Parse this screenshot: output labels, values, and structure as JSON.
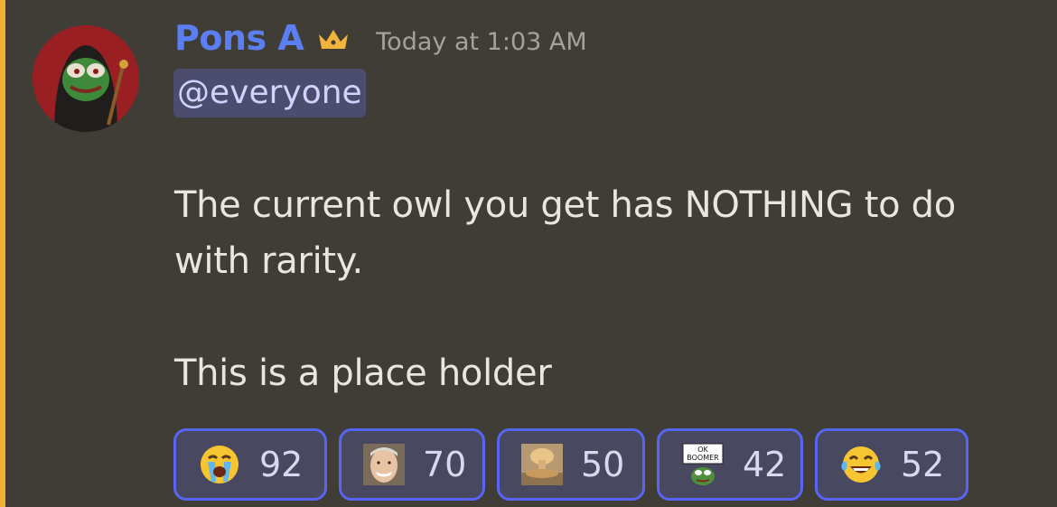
{
  "message": {
    "author": "Pons A",
    "author_badge": "crown-icon",
    "timestamp": "Today at 1:03 AM",
    "mention": "@everyone",
    "lines": [
      "The current owl you get has NOTHING to do",
      "with rarity.",
      "This is a place holder"
    ]
  },
  "reactions": [
    {
      "emoji": "loudly-crying-face",
      "count": "92"
    },
    {
      "emoji": "hide-the-pain-harold",
      "count": "70"
    },
    {
      "emoji": "explosion",
      "count": "50"
    },
    {
      "emoji": "ok-boomer-pepe",
      "emoji_text": "OK BOOMER",
      "count": "42"
    },
    {
      "emoji": "tears-of-joy-face",
      "count": "52"
    }
  ],
  "colors": {
    "background": "#403d37",
    "mention_bar": "#f0b132",
    "username": "#5b7ef3",
    "mention_bg": "#4c4d6e",
    "reaction_border": "#5865f2"
  }
}
